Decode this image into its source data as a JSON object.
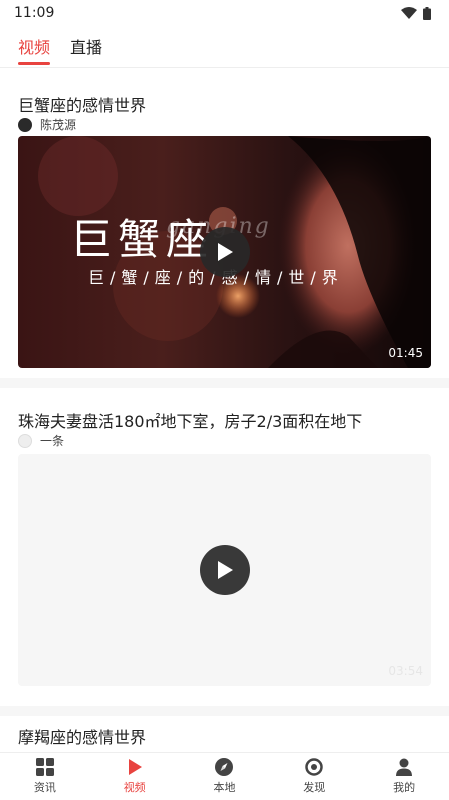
{
  "status": {
    "time": "11:09"
  },
  "tabs": [
    {
      "label": "视频",
      "active": true
    },
    {
      "label": "直播",
      "active": false
    }
  ],
  "feed": [
    {
      "title": "巨蟹座的感情世界",
      "author": "陈茂源",
      "duration": "01:45",
      "overlay_title": "巨蟹座",
      "overlay_subtitle": "巨/蟹/座/的/感/情/世/界",
      "overlay_en": "ganging"
    },
    {
      "title": "珠海夫妻盘活180㎡地下室，房子2/3面积在地下",
      "author": "一条",
      "duration": "03:54"
    },
    {
      "title": "摩羯座的感情世界"
    }
  ],
  "bottom_nav": [
    {
      "label": "资讯",
      "icon": "grid-icon",
      "active": false
    },
    {
      "label": "视频",
      "icon": "play-icon",
      "active": true
    },
    {
      "label": "本地",
      "icon": "location-icon",
      "active": false
    },
    {
      "label": "发现",
      "icon": "discover-icon",
      "active": false
    },
    {
      "label": "我的",
      "icon": "user-icon",
      "active": false
    }
  ],
  "colors": {
    "accent": "#e8433f",
    "separator": "#f6f6f6"
  }
}
